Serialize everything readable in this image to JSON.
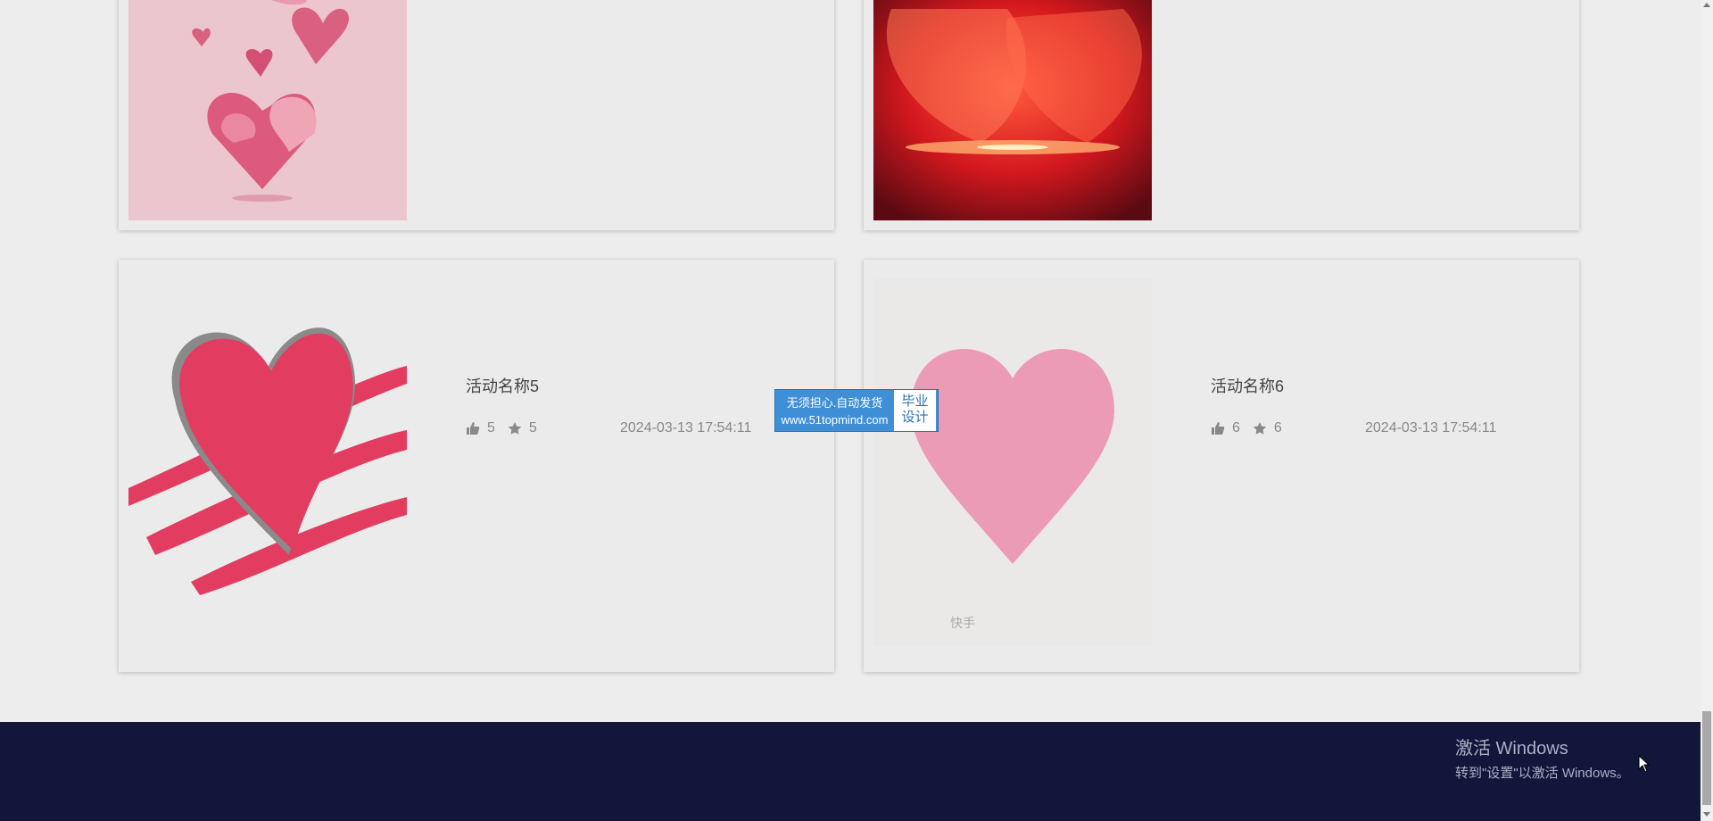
{
  "cards": [
    {
      "title": "",
      "likes": "",
      "favorites": "",
      "date": ""
    },
    {
      "title": "",
      "likes": "",
      "favorites": "",
      "date": ""
    },
    {
      "title": "活动名称5",
      "likes": "5",
      "favorites": "5",
      "date": "2024-03-13 17:54:11"
    },
    {
      "title": "活动名称6",
      "likes": "6",
      "favorites": "6",
      "date": "2024-03-13 17:54:11"
    }
  ],
  "icons": {
    "like": "thumbs-up-icon",
    "favorite": "star-icon"
  },
  "image_watermark": "快手",
  "ad_watermark": {
    "line1": "无须担心.自动发货",
    "line2": "www.51topmind.com",
    "side_top": "毕业",
    "side_bottom": "设计"
  },
  "windows_activation": {
    "title": "激活 Windows",
    "subtitle": "转到\"设置\"以激活 Windows。"
  },
  "colors": {
    "footer": "#11163a",
    "page_bg": "#ededed",
    "card_bg": "#ebebeb",
    "ad_blue": "#3f8fd6"
  }
}
